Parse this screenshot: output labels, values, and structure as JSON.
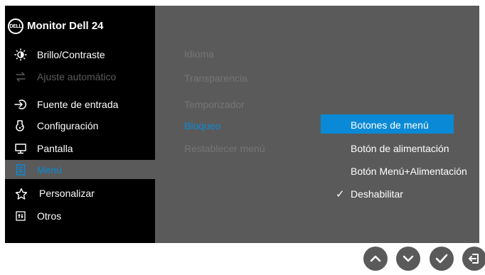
{
  "header": {
    "brand_logo_text": "DELL",
    "title": "Monitor Dell 24"
  },
  "main_menu": [
    {
      "label": "Brillo/Contraste",
      "icon": "brightness-icon",
      "state": "normal"
    },
    {
      "label": "Ajuste automático",
      "icon": "auto-adjust-icon",
      "state": "disabled"
    },
    {
      "label": "Fuente de entrada",
      "icon": "input-source-icon",
      "state": "normal"
    },
    {
      "label": "Configuración",
      "icon": "color-icon",
      "state": "normal"
    },
    {
      "label": "Pantalla",
      "icon": "display-icon",
      "state": "normal"
    },
    {
      "label": "Menú",
      "icon": "menu-icon",
      "state": "selected"
    },
    {
      "label": "Personalizar",
      "icon": "star-icon",
      "state": "normal"
    },
    {
      "label": "Otros",
      "icon": "others-icon",
      "state": "normal"
    }
  ],
  "submenu": [
    {
      "label": "Idioma",
      "state": "dim"
    },
    {
      "label": "Transparencia",
      "state": "dim"
    },
    {
      "label": "Temporizador",
      "state": "dim"
    },
    {
      "label": "Bloqueo",
      "state": "selected"
    },
    {
      "label": "Restablecer menú",
      "state": "dim"
    }
  ],
  "lock_options": [
    {
      "label": "Botones de menú",
      "state": "highlighted"
    },
    {
      "label": "Botón de alimentación",
      "state": "normal"
    },
    {
      "label": "Botón Menú+Alimentación",
      "state": "normal"
    },
    {
      "label": "Deshabilitar",
      "state": "checked",
      "check_mark": "✓"
    }
  ],
  "buttons": [
    {
      "icon": "up-arrow-icon"
    },
    {
      "icon": "down-arrow-icon"
    },
    {
      "icon": "check-icon"
    },
    {
      "icon": "exit-icon"
    }
  ],
  "colors": {
    "panel_dark": "#000000",
    "panel_gray": "#5a5a5a",
    "accent_blue": "#0a8ad6",
    "text_white": "#ffffff",
    "text_dim": "#767676",
    "text_disabled": "#5c5c5c"
  }
}
